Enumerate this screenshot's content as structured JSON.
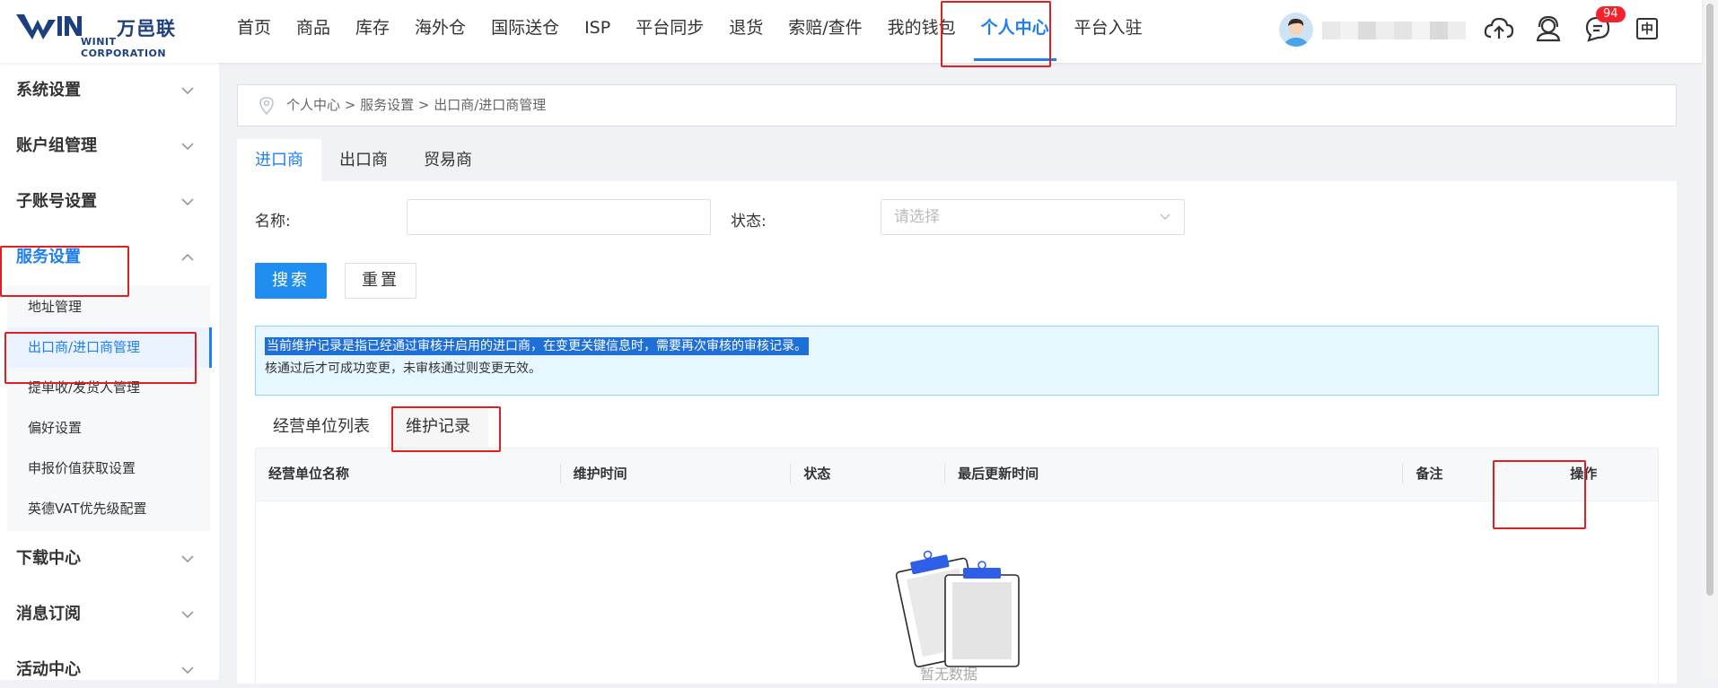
{
  "logo": {
    "cn": "万邑联",
    "en": "WINIT CORPORATION"
  },
  "nav": [
    "首页",
    "商品",
    "库存",
    "海外仓",
    "国际送仓",
    "ISP",
    "平台同步",
    "退货",
    "索赔/查件",
    "我的钱包",
    "个人中心",
    "平台入驻"
  ],
  "nav_active": "个人中心",
  "header": {
    "badge_count": "94",
    "lang": "中"
  },
  "sidebar": {
    "groups_before": [
      {
        "label": "系统设置"
      },
      {
        "label": "账户组管理"
      },
      {
        "label": "子账号设置"
      }
    ],
    "active_group": {
      "label": "服务设置"
    },
    "sub_items": [
      "地址管理",
      "出口商/进口商管理",
      "提单收/发货人管理",
      "偏好设置",
      "申报价值获取设置",
      "英德VAT优先级配置"
    ],
    "active_sub": "出口商/进口商管理",
    "groups_after": [
      {
        "label": "下载中心"
      },
      {
        "label": "消息订阅"
      },
      {
        "label": "活动中心"
      }
    ]
  },
  "breadcrumb": "个人中心 > 服务设置 > 出口商/进口商管理",
  "tabs": [
    "进口商",
    "出口商",
    "贸易商"
  ],
  "active_tab": "进口商",
  "form": {
    "name_label": "名称:",
    "name_value": "",
    "status_label": "状态:",
    "status_placeholder": "请选择",
    "search_btn": "搜索",
    "reset_btn": "重置"
  },
  "notice": {
    "line1": "当前维护记录是指已经通过审核并启用的进口商，在变更关键信息时，需要再次审核的审核记录。",
    "line2": "核通过后才可成功变更，未审核通过则变更无效。"
  },
  "subtabs": [
    "经营单位列表",
    "维护记录"
  ],
  "active_subtab": "维护记录",
  "table": {
    "columns": [
      "经营单位名称",
      "维护时间",
      "状态",
      "最后更新时间",
      "备注",
      "操作"
    ],
    "rows": [],
    "empty_text": "暂无数据"
  },
  "colors": {
    "accent": "#1f7ef0",
    "highlight_box": "#e02020",
    "notice_bg": "#e6f7ff"
  }
}
